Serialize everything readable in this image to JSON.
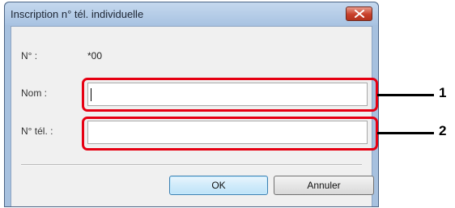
{
  "dialog": {
    "title": "Inscription n° tél. individuelle",
    "close_icon": "close-icon",
    "close_color": "#c8402a"
  },
  "form": {
    "number_label": "N° :",
    "number_value": "*00",
    "name_label": "Nom :",
    "name_value": "",
    "phone_label": "N° tél. :",
    "phone_value": ""
  },
  "buttons": {
    "ok": "OK",
    "cancel": "Annuler"
  },
  "callouts": [
    "1",
    "2"
  ],
  "highlight_color": "#e60012"
}
